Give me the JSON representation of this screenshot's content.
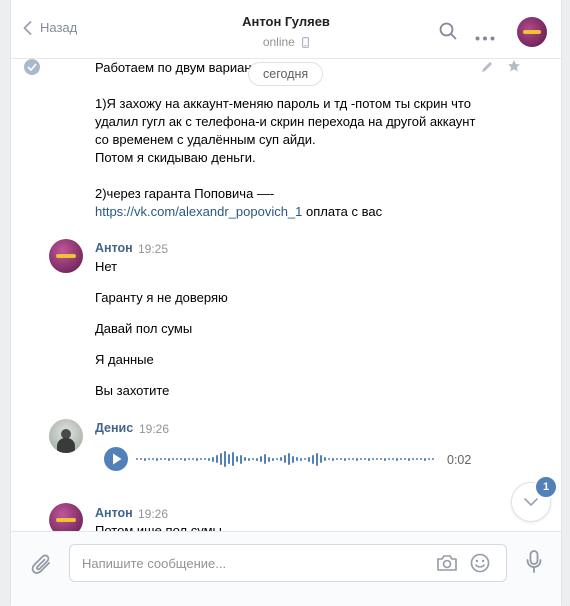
{
  "header": {
    "back_label": "Назад",
    "chat_name": "Антон Гуляев",
    "status": "online"
  },
  "feed": {
    "date_pill": "сегодня",
    "first_message_lines": [
      "Работаем по двум вариант",
      "",
      "1)Я захожу на аккаунт-меняю пароль и тд -потом ты скрин что",
      "удалил гугл ак с телефона-и скрин перехода на другой аккаунт",
      "со временем с удалённым суп айди.",
      "Потом я скидываю деньги.",
      "",
      "2)через гаранта Поповича —-"
    ],
    "link_text": "https://vk.com/alexandr_popovich_1",
    "link_suffix": " оплата с вас",
    "group1": {
      "author": "Антон",
      "time": "19:25",
      "messages": [
        "Нет",
        "Гаранту я не доверяю",
        "Давай пол сумы",
        "Я данные",
        "Вы захотите"
      ]
    },
    "group2": {
      "author": "Денис",
      "time": "19:26",
      "voice_duration": "0:02"
    },
    "group3": {
      "author": "Антон",
      "time": "19:26",
      "message": "Потом ище пол сумы"
    },
    "unread_badge": "1"
  },
  "composer": {
    "placeholder": "Напишите сообщение..."
  },
  "colors": {
    "accent": "#5181b8",
    "author": "#42648b",
    "link": "#2a5885"
  }
}
